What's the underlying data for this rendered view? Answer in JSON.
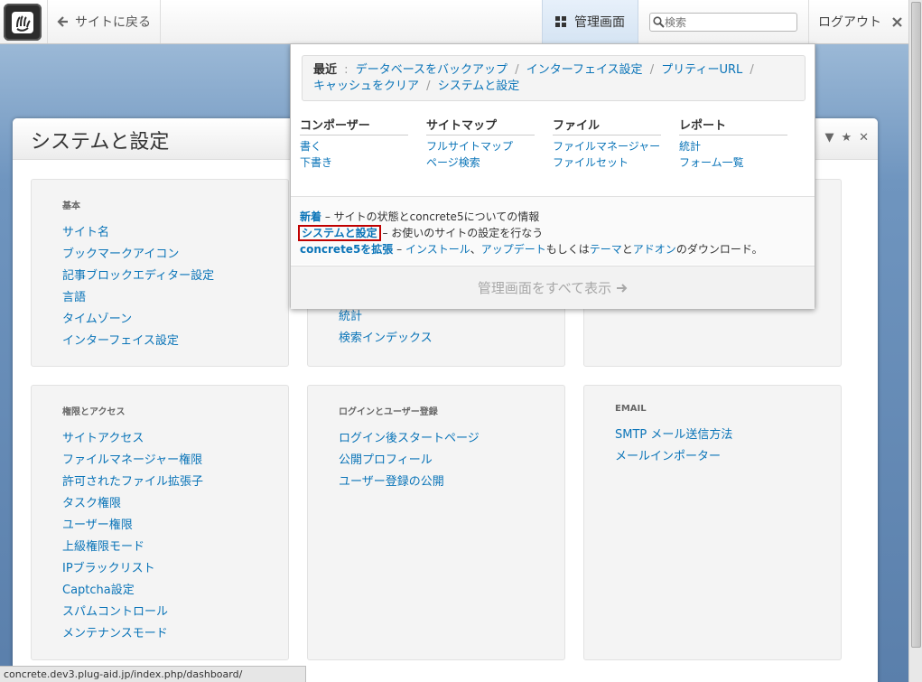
{
  "toolbar": {
    "back_label": "サイトに戻る",
    "dashboard_label": "管理画面",
    "search_placeholder": "検索",
    "logout_label": "ログアウト"
  },
  "page": {
    "title": "システムと設定"
  },
  "sections": [
    {
      "heading": "基本",
      "items": [
        "サイト名",
        "ブックマークアイコン",
        "記事ブロックエディター設定",
        "言語",
        "タイムゾーン",
        "インターフェイス設定"
      ]
    },
    {
      "heading": "",
      "items": [
        "統計",
        "検索インデックス"
      ]
    },
    {
      "heading": "権限とアクセス",
      "items": [
        "サイトアクセス",
        "ファイルマネージャー権限",
        "許可されたファイル拡張子",
        "タスク権限",
        "ユーザー権限",
        "上級権限モード",
        "IPブラックリスト",
        "Captcha設定",
        "スパムコントロール",
        "メンテナンスモード"
      ]
    },
    {
      "heading": "ログインとユーザー登録",
      "items": [
        "ログイン後スタートページ",
        "公開プロフィール",
        "ユーザー登録の公開"
      ]
    },
    {
      "heading": "EMAIL",
      "items": [
        "SMTP メール送信方法",
        "メールインポーター"
      ]
    }
  ],
  "dropdown": {
    "recent_label": "最近",
    "recent_sep": ":",
    "recent_items": [
      "データベースをバックアップ",
      "インターフェイス設定",
      "プリティーURL",
      "キャッシュをクリア",
      "システムと設定"
    ],
    "columns": [
      {
        "title": "コンポーザー",
        "items": [
          "書く",
          "下書き"
        ]
      },
      {
        "title": "サイトマップ",
        "items": [
          "フルサイトマップ",
          "ページ検索"
        ]
      },
      {
        "title": "ファイル",
        "items": [
          "ファイルマネージャー",
          "ファイルセット"
        ]
      },
      {
        "title": "レポート",
        "items": [
          "統計",
          "フォーム一覧"
        ]
      }
    ],
    "news_link": "新着",
    "news_text": "– サイトの状態とconcrete5についての情報",
    "settings_link": "システムと設定",
    "settings_text": "– お使いのサイトの設定を行なう",
    "extend_link": "concrete5を拡張",
    "extend_dash": "–",
    "extend_install": "インストール",
    "extend_comma": "、",
    "extend_update": "アップデート",
    "extend_or": "もしくは",
    "extend_theme": "テーマ",
    "extend_and": "と",
    "extend_addon": "アドオン",
    "extend_tail": "のダウンロード。",
    "show_all": "管理画面をすべて表示"
  },
  "status_bar": "concrete.dev3.plug-aid.jp/index.php/dashboard/",
  "colors": {
    "link": "#0a74b8",
    "highlight_border": "#c00000",
    "dashboard_active": "#dde9f6"
  }
}
